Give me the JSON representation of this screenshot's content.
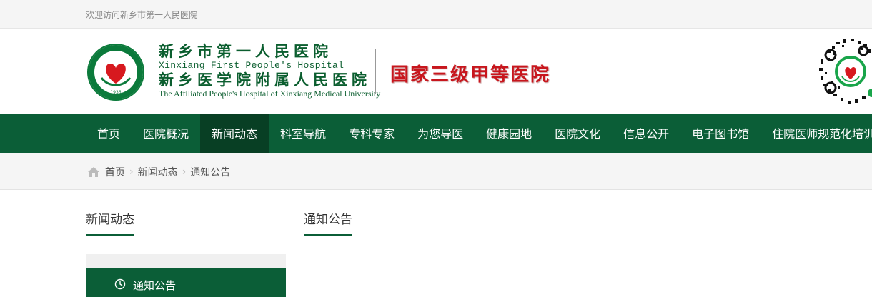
{
  "topbar": {
    "welcome": "欢迎访问新乡市第一人民医院"
  },
  "header": {
    "logo_cn1": "新乡市第一人民医院",
    "logo_en1": "Xinxiang First People's Hospital",
    "logo_cn2": "新乡医学院附属人民医院",
    "logo_en2": "The Affiliated People's Hospital of Xinxiang Medical University",
    "emblem_year": "1936",
    "grade": "国家三级甲等医院"
  },
  "nav": {
    "items": [
      {
        "label": "首页"
      },
      {
        "label": "医院概况"
      },
      {
        "label": "新闻动态",
        "active": true
      },
      {
        "label": "科室导航"
      },
      {
        "label": "专科专家"
      },
      {
        "label": "为您导医"
      },
      {
        "label": "健康园地"
      },
      {
        "label": "医院文化"
      },
      {
        "label": "信息公开"
      },
      {
        "label": "电子图书馆"
      },
      {
        "label": "住院医师规范化培训"
      }
    ]
  },
  "breadcrumb": {
    "items": [
      "首页",
      "新闻动态",
      "通知公告"
    ],
    "icon": "home-icon"
  },
  "sidebar": {
    "title": "新闻动态",
    "items": [
      {
        "label": "通知公告",
        "icon": "clock-icon"
      }
    ]
  },
  "main": {
    "title": "通知公告"
  },
  "colors": {
    "brand_green": "#0b5e37",
    "nav_active": "#083f24",
    "grade_red": "#c8161d"
  }
}
